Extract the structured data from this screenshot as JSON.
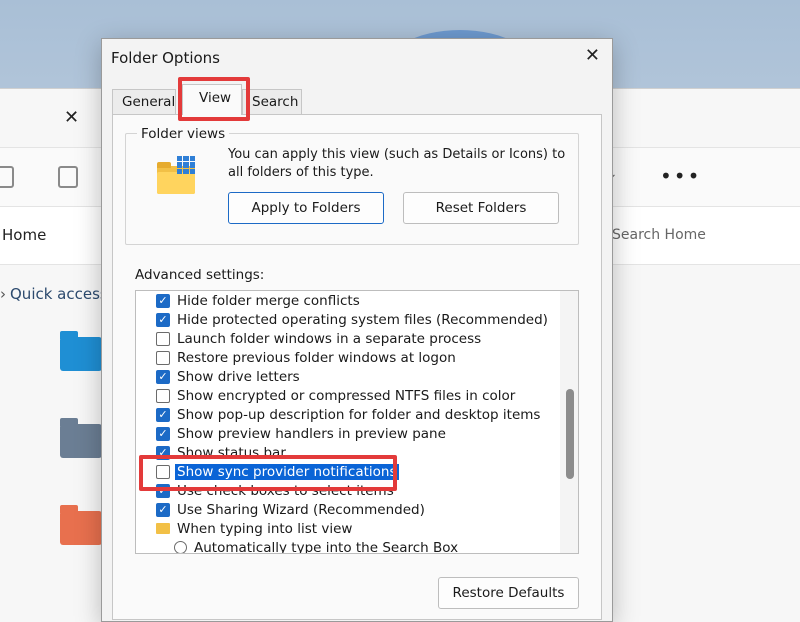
{
  "explorer": {
    "home_label": "Home",
    "search_placeholder": "Search Home",
    "quick_access": "Quick access",
    "more_label": "•••"
  },
  "dialog": {
    "title": "Folder Options",
    "tabs": [
      {
        "label": "General"
      },
      {
        "label": "View"
      },
      {
        "label": "Search"
      }
    ],
    "folder_views": {
      "legend": "Folder views",
      "description": "You can apply this view (such as Details or Icons) to all folders of this type.",
      "apply_button": "Apply to Folders",
      "reset_button": "Reset Folders"
    },
    "advanced_label": "Advanced settings:",
    "settings": [
      {
        "label": "Hide folder merge conflicts",
        "checked": true
      },
      {
        "label": "Hide protected operating system files (Recommended)",
        "checked": true
      },
      {
        "label": "Launch folder windows in a separate process",
        "checked": false
      },
      {
        "label": "Restore previous folder windows at logon",
        "checked": false
      },
      {
        "label": "Show drive letters",
        "checked": true
      },
      {
        "label": "Show encrypted or compressed NTFS files in color",
        "checked": false
      },
      {
        "label": "Show pop-up description for folder and desktop items",
        "checked": true
      },
      {
        "label": "Show preview handlers in preview pane",
        "checked": true
      },
      {
        "label": "Show status bar",
        "checked": true
      },
      {
        "label": "Show sync provider notifications",
        "checked": false,
        "selected": true
      },
      {
        "label": "Use check boxes to select items",
        "checked": true
      },
      {
        "label": "Use Sharing Wizard (Recommended)",
        "checked": true
      },
      {
        "label": "When typing into list view",
        "kind": "folder"
      },
      {
        "label": "Automatically type into the Search Box",
        "kind": "radio"
      }
    ],
    "restore_button": "Restore Defaults"
  },
  "colors": {
    "accent": "#1c6ac6",
    "selection": "#0a64d6",
    "highlight": "#e33a3a"
  }
}
